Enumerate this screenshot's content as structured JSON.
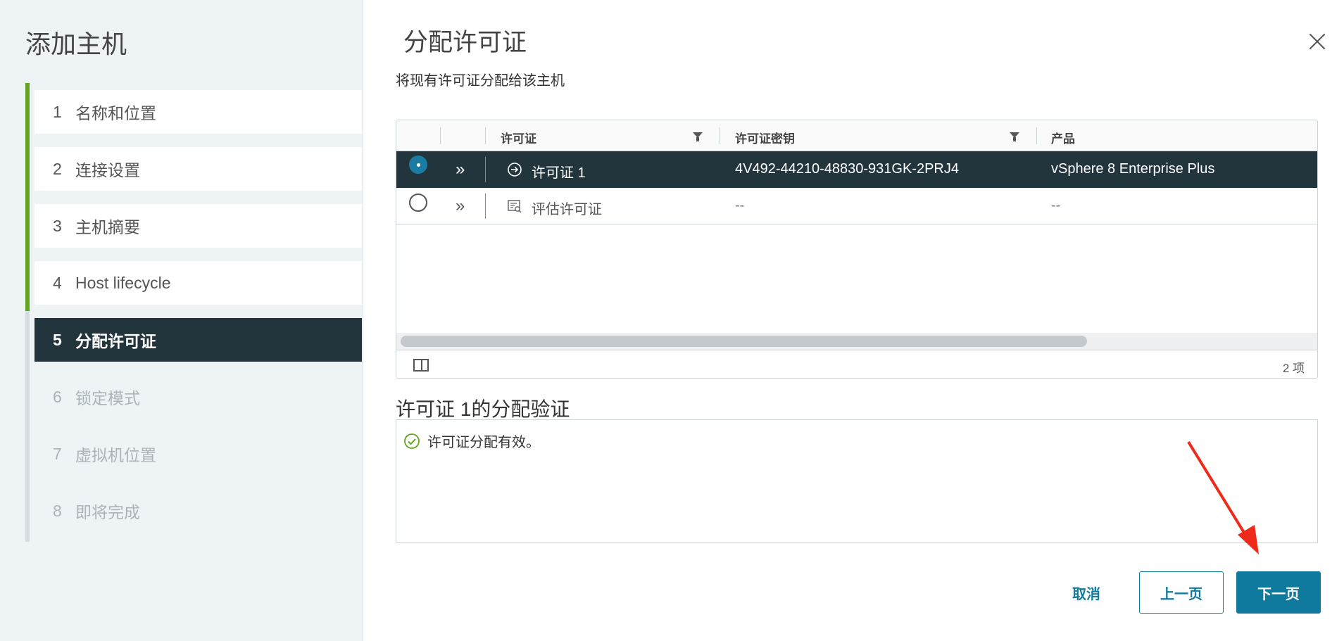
{
  "sidebar": {
    "title": "添加主机",
    "steps": [
      {
        "num": "1",
        "label": "名称和位置"
      },
      {
        "num": "2",
        "label": "连接设置"
      },
      {
        "num": "3",
        "label": "主机摘要"
      },
      {
        "num": "4",
        "label": "Host lifecycle"
      },
      {
        "num": "5",
        "label": "分配许可证"
      },
      {
        "num": "6",
        "label": "锁定模式"
      },
      {
        "num": "7",
        "label": "虚拟机位置"
      },
      {
        "num": "8",
        "label": "即将完成"
      }
    ]
  },
  "main": {
    "title": "分配许可证",
    "subtitle": "将现有许可证分配给该主机"
  },
  "grid": {
    "columns": [
      "许可证",
      "许可证密钥",
      "产品"
    ],
    "rows": [
      {
        "license": "许可证 1",
        "key": "4V492-44210-48830-931GK-2PRJ4",
        "product": "vSphere 8 Enterprise Plus",
        "selected": true
      },
      {
        "license": "评估许可证",
        "key": "--",
        "product": "--",
        "selected": false
      }
    ],
    "footer_count": "2 项"
  },
  "validation": {
    "title": "许可证 1的分配验证",
    "message": "许可证分配有效。"
  },
  "buttons": {
    "cancel": "取消",
    "prev": "上一页",
    "next": "下一页"
  },
  "colors": {
    "accent": "#0f7a9e",
    "done_step_bar": "#62a420",
    "selected_row": "#22343c",
    "annotation_arrow": "#f02a1a"
  }
}
